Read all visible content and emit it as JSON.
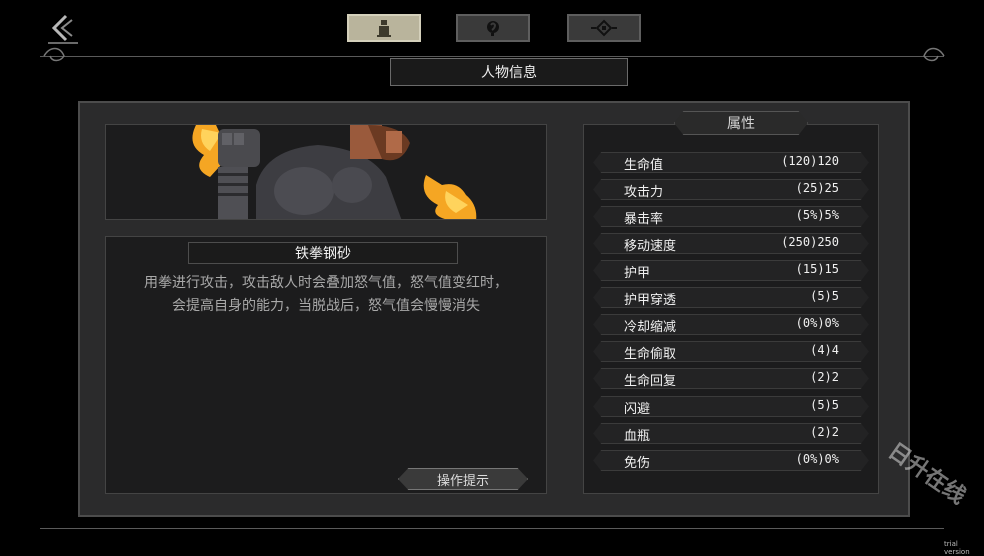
{
  "nav": {
    "tabs": [
      {
        "icon": "character-icon",
        "active": true
      },
      {
        "icon": "skill-icon",
        "active": false
      },
      {
        "icon": "relic-icon",
        "active": false
      }
    ],
    "page_title": "人物信息"
  },
  "skill": {
    "name": "铁拳钢砂",
    "description_line1": "用拳进行攻击，攻击敌人时会叠加怒气值，怒气值变红时，",
    "description_line2": "会提高自身的能力，当脱战后，怒气值会慢慢消失",
    "hint_button": "操作提示"
  },
  "attributes": {
    "title": "属性",
    "rows": [
      {
        "label": "生命值",
        "value": "(120)120"
      },
      {
        "label": "攻击力",
        "value": "(25)25"
      },
      {
        "label": "暴击率",
        "value": "(5%)5%"
      },
      {
        "label": "移动速度",
        "value": "(250)250"
      },
      {
        "label": "护甲",
        "value": "(15)15"
      },
      {
        "label": "护甲穿透",
        "value": "(5)5"
      },
      {
        "label": "冷却缩减",
        "value": "(0%)0%"
      },
      {
        "label": "生命偷取",
        "value": "(4)4"
      },
      {
        "label": "生命回复",
        "value": "(2)2"
      },
      {
        "label": "闪避",
        "value": "(5)5"
      },
      {
        "label": "血瓶",
        "value": "(2)2"
      },
      {
        "label": "免伤",
        "value": "(0%)0%"
      }
    ]
  },
  "watermark": "日升在线",
  "trial_label": "trial version",
  "colors": {
    "background": "#000000",
    "panel": "#1c1c1d",
    "frame": "#2b2b2c",
    "active_tab": "#b9b49c",
    "flame": "#f5a623"
  }
}
